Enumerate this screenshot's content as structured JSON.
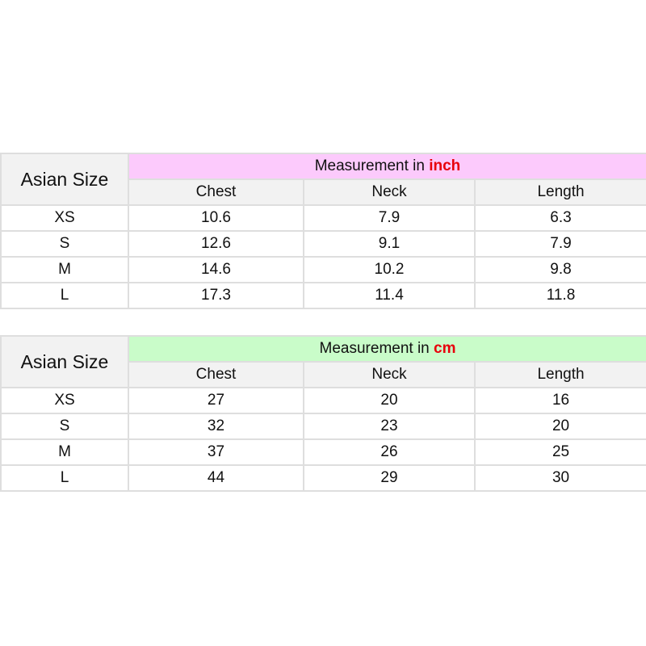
{
  "tables": [
    {
      "size_header": "Asian Size",
      "group_prefix": "Measurement in ",
      "unit": "inch",
      "group_color": "#fccafc",
      "columns": [
        "Chest",
        "Neck",
        "Length"
      ],
      "rows": [
        [
          "XS",
          "10.6",
          "7.9",
          "6.3"
        ],
        [
          "S",
          "12.6",
          "9.1",
          "7.9"
        ],
        [
          "M",
          "14.6",
          "10.2",
          "9.8"
        ],
        [
          "L",
          "17.3",
          "11.4",
          "11.8"
        ]
      ]
    },
    {
      "size_header": "Asian Size",
      "group_prefix": "Measurement in ",
      "unit": "cm",
      "group_color": "#c9fcc9",
      "columns": [
        "Chest",
        "Neck",
        "Length"
      ],
      "rows": [
        [
          "XS",
          "27",
          "20",
          "16"
        ],
        [
          "S",
          "32",
          "23",
          "20"
        ],
        [
          "M",
          "37",
          "26",
          "25"
        ],
        [
          "L",
          "44",
          "29",
          "30"
        ]
      ]
    }
  ]
}
